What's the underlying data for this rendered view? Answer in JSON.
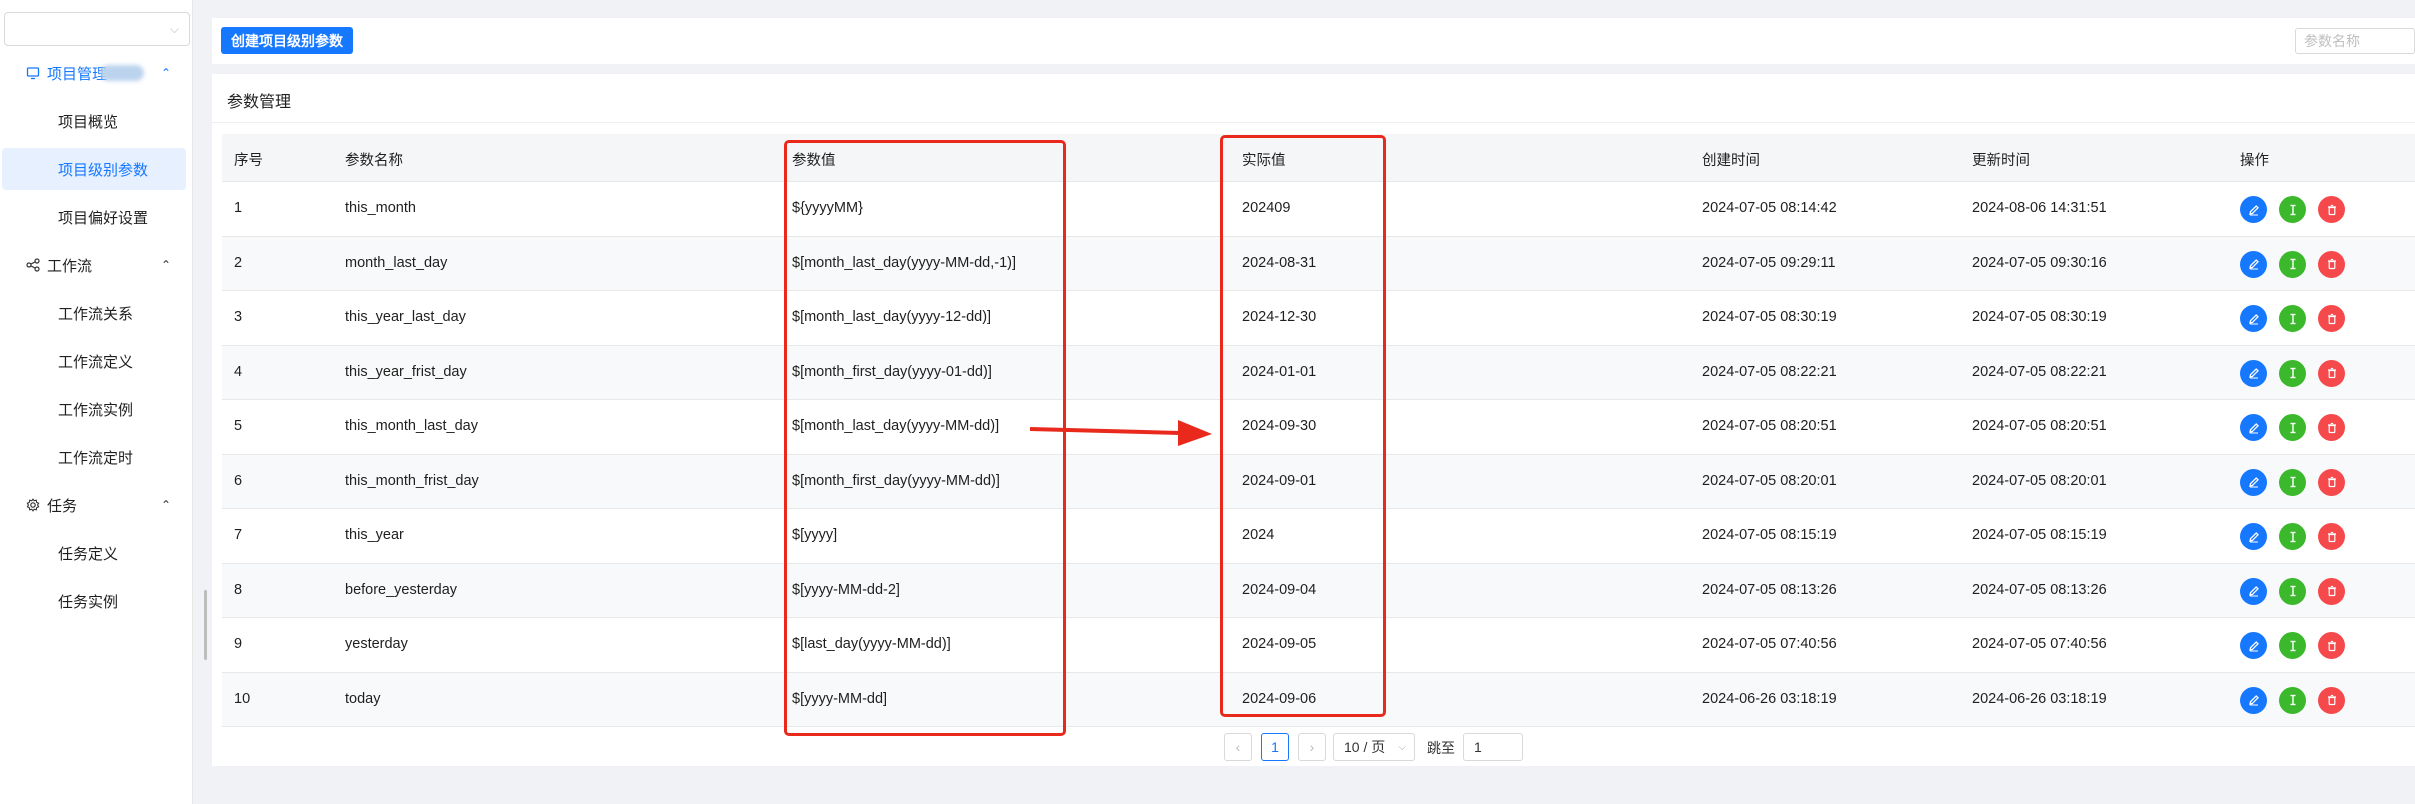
{
  "sidebar": {
    "groups": [
      {
        "label": "项目管理",
        "icon": "monitor-icon",
        "arrow": "⌃",
        "items": [
          {
            "label": "项目概览"
          },
          {
            "label": "项目级别参数"
          },
          {
            "label": "项目偏好设置"
          }
        ]
      },
      {
        "label": "工作流",
        "icon": "share-icon",
        "arrow": "⌃",
        "items": [
          {
            "label": "工作流关系"
          },
          {
            "label": "工作流定义"
          },
          {
            "label": "工作流实例"
          },
          {
            "label": "工作流定时"
          }
        ]
      },
      {
        "label": "任务",
        "icon": "gear-icon",
        "arrow": "⌃",
        "items": [
          {
            "label": "任务定义"
          },
          {
            "label": "任务实例"
          }
        ]
      }
    ]
  },
  "toolbar": {
    "create_label": "创建项目级别参数",
    "search_placeholder": "参数名称"
  },
  "card": {
    "title": "参数管理"
  },
  "table": {
    "columns": [
      "序号",
      "参数名称",
      "参数值",
      "实际值",
      "创建时间",
      "更新时间",
      "操作"
    ],
    "rows": [
      [
        "1",
        "this_month",
        "${yyyyMM}",
        "202409",
        "2024-07-05 08:14:42",
        "2024-08-06 14:31:51"
      ],
      [
        "2",
        "month_last_day",
        "$[month_last_day(yyyy-MM-dd,-1)]",
        "2024-08-31",
        "2024-07-05 09:29:11",
        "2024-07-05 09:30:16"
      ],
      [
        "3",
        "this_year_last_day",
        "$[month_last_day(yyyy-12-dd)]",
        "2024-12-30",
        "2024-07-05 08:30:19",
        "2024-07-05 08:30:19"
      ],
      [
        "4",
        "this_year_frist_day",
        "$[month_first_day(yyyy-01-dd)]",
        "2024-01-01",
        "2024-07-05 08:22:21",
        "2024-07-05 08:22:21"
      ],
      [
        "5",
        "this_month_last_day",
        "$[month_last_day(yyyy-MM-dd)]",
        "2024-09-30",
        "2024-07-05 08:20:51",
        "2024-07-05 08:20:51"
      ],
      [
        "6",
        "this_month_frist_day",
        "$[month_first_day(yyyy-MM-dd)]",
        "2024-09-01",
        "2024-07-05 08:20:01",
        "2024-07-05 08:20:01"
      ],
      [
        "7",
        "this_year",
        "$[yyyy]",
        "2024",
        "2024-07-05 08:15:19",
        "2024-07-05 08:15:19"
      ],
      [
        "8",
        "before_yesterday",
        "$[yyyy-MM-dd-2]",
        "2024-09-04",
        "2024-07-05 08:13:26",
        "2024-07-05 08:13:26"
      ],
      [
        "9",
        "yesterday",
        "$[last_day(yyyy-MM-dd)]",
        "2024-09-05",
        "2024-07-05 07:40:56",
        "2024-07-05 07:40:56"
      ],
      [
        "10",
        "today",
        "$[yyyy-MM-dd]",
        "2024-09-06",
        "2024-06-26 03:18:19",
        "2024-06-26 03:18:19"
      ]
    ]
  },
  "pagination": {
    "prev": "‹",
    "current": "1",
    "next": "›",
    "page_size": "10 / 页",
    "jump_label": "跳至",
    "jump_value": "1"
  },
  "colors": {
    "primary": "#1677ff",
    "success": "#3bb82c",
    "danger": "#f5494b",
    "annotation": "#e8291c"
  }
}
